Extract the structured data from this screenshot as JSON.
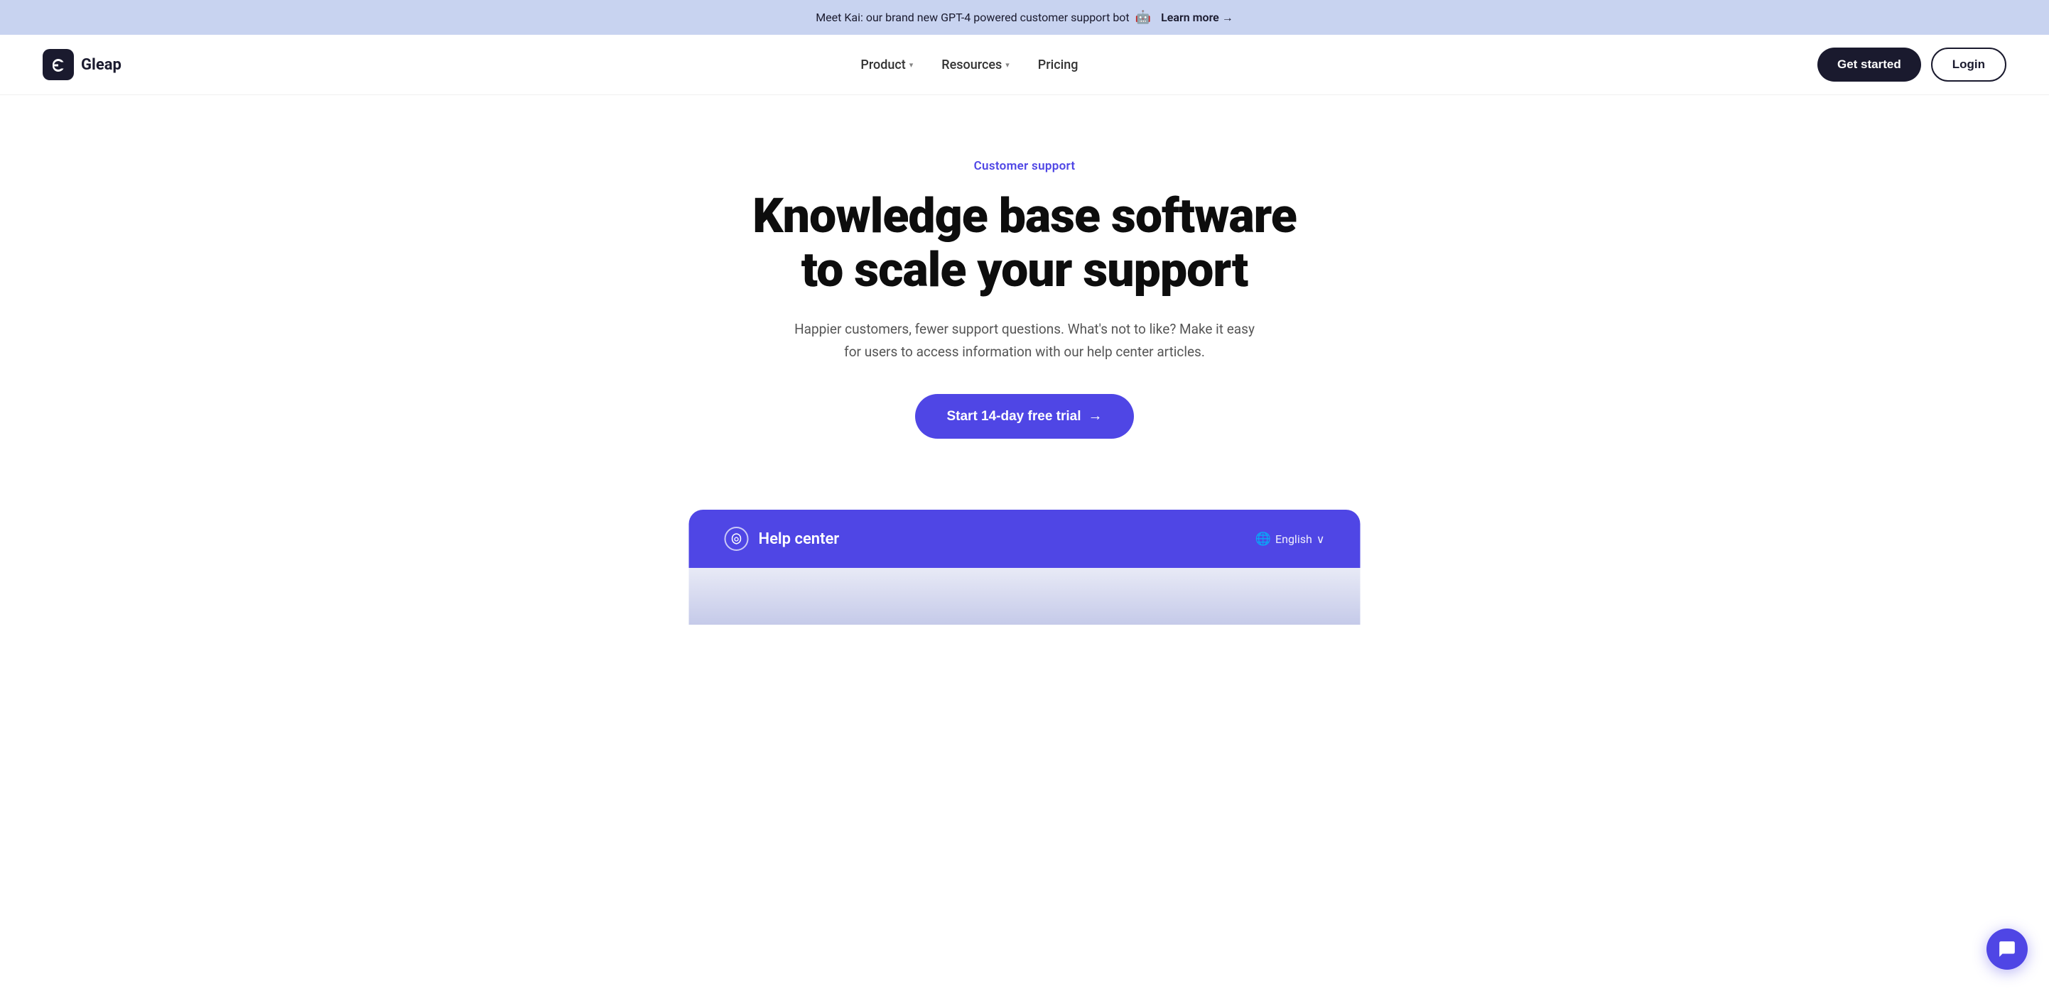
{
  "banner": {
    "text": "Meet Kai: our brand new GPT-4 powered customer support bot",
    "emoji": "🤖",
    "learn_more_label": "Learn more",
    "arrow": "→"
  },
  "navbar": {
    "logo_text": "Gleap",
    "nav_items": [
      {
        "label": "Product",
        "has_dropdown": true
      },
      {
        "label": "Resources",
        "has_dropdown": true
      },
      {
        "label": "Pricing",
        "has_dropdown": false
      }
    ],
    "get_started_label": "Get started",
    "login_label": "Login"
  },
  "hero": {
    "tag": "Customer support",
    "title": "Knowledge base software to scale your support",
    "subtitle": "Happier customers, fewer support questions. What's not to like? Make it easy for users to access information with our help center articles.",
    "cta_label": "Start 14-day free trial",
    "cta_arrow": "→"
  },
  "help_center": {
    "title": "Help center",
    "language_label": "English",
    "chevron": "∨"
  },
  "chat_button": {
    "label": "Open chat"
  }
}
